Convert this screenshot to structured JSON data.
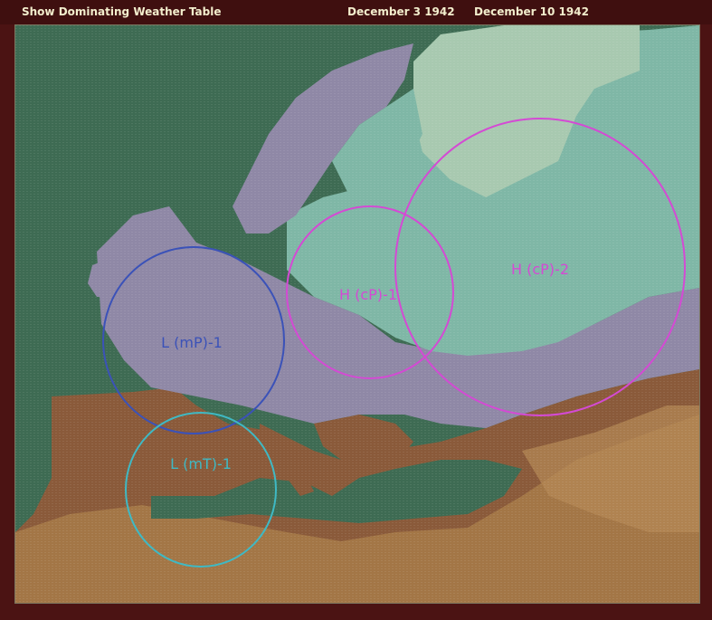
{
  "header": {
    "show_table_label": "Show Dominating Weather Table",
    "date_from": "December  3  1942",
    "date_to": "December  10  1942"
  },
  "weather_systems": [
    {
      "label": "L (mP)-1",
      "color": "#3b52b8"
    },
    {
      "label": "L (mT)-1",
      "color": "#3fb9c4"
    },
    {
      "label": "H (cP)-1",
      "color": "#d44ad4"
    },
    {
      "label": "H (cP)-2",
      "color": "#d44ad4"
    }
  ],
  "colors": {
    "sea": "#3e6b53",
    "cold_zone": "#7fb7a6",
    "arctic_zone": "#a8c9b0",
    "temperate_zone": "#8f88a6",
    "warm_land": "#8a5a3a",
    "dry_land": "#a77b49",
    "border": "#4b1313"
  }
}
